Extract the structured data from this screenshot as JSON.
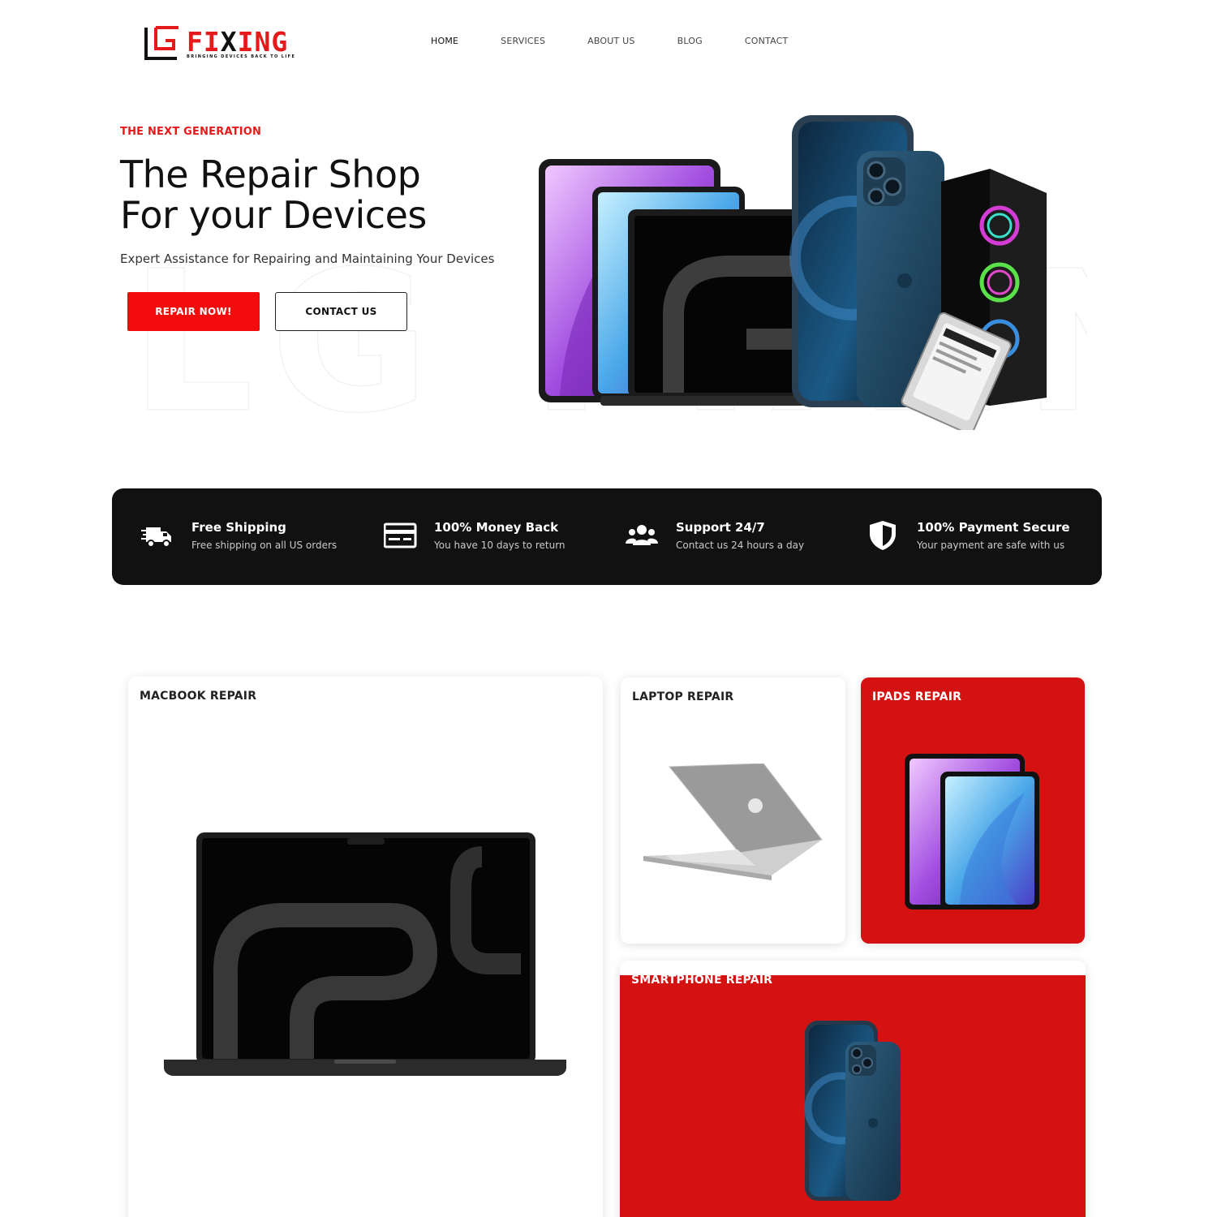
{
  "brand": {
    "name_left": "FI",
    "name_x": "X",
    "name_right": "ING",
    "tagline": "BRINGING DEVICES BACK TO LIFE"
  },
  "nav": {
    "items": [
      "HOME",
      "SERVICES",
      "ABOUT US",
      "BLOG",
      "CONTACT"
    ],
    "active": "HOME"
  },
  "hero": {
    "eyebrow": "THE NEXT GENERATION",
    "title_line1": "The Repair Shop",
    "title_line2_prefix": "For your ",
    "title_line2_highlight": "Devices",
    "subtitle": "Expert Assistance for Repairing and Maintaining Your Devices",
    "primary_button": "REPAIR NOW!",
    "secondary_button": "CONTACT US",
    "watermark": "LG FIXING"
  },
  "features": [
    {
      "icon": "delivery-truck-icon",
      "title": "Free Shipping",
      "desc": "Free shipping on all US orders"
    },
    {
      "icon": "credit-card-icon",
      "title": "100% Money Back",
      "desc": "You have 10 days to return"
    },
    {
      "icon": "users-icon",
      "title": "Support 24/7",
      "desc": "Contact us 24 hours a day"
    },
    {
      "icon": "shield-icon",
      "title": "100% Payment Secure",
      "desc": "Your payment are safe with us"
    }
  ],
  "services": {
    "macbook": "MACBOOK REPAIR",
    "laptop": "LAPTOP REPAIR",
    "ipads": "IPADS REPAIR",
    "smartphone": "SMARTPHONE REPAIR"
  },
  "colors": {
    "accent": "#e51b1b",
    "button": "#f20c0c",
    "feature_bar": "#111111",
    "card_red": "#d41212"
  }
}
